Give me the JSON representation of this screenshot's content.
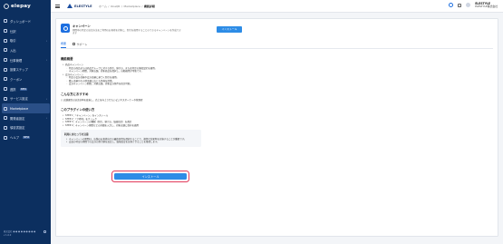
{
  "sidebar": {
    "brand": "elepay",
    "items": [
      {
        "label": "ダッシュボード",
        "icon": "dashboard-icon",
        "caret": false,
        "badge": ""
      },
      {
        "label": "仕訳",
        "icon": "journal-icon",
        "caret": false,
        "badge": ""
      },
      {
        "label": "取引",
        "icon": "transaction-icon",
        "caret": true,
        "badge": ""
      },
      {
        "label": "入出",
        "icon": "wallet-icon",
        "caret": false,
        "badge": ""
      },
      {
        "label": "仕事管理",
        "icon": "briefcase-icon",
        "caret": true,
        "badge": ""
      },
      {
        "label": "設置ステップ",
        "icon": "steps-icon",
        "caret": false,
        "badge": ""
      },
      {
        "label": "クーポン",
        "icon": "coupon-icon",
        "caret": false,
        "badge": ""
      },
      {
        "label": "連携",
        "icon": "link-icon",
        "caret": false,
        "badge": "NEW"
      },
      {
        "label": "サービス設定",
        "icon": "settings-icon",
        "caret": true,
        "badge": ""
      },
      {
        "label": "Marketplace",
        "icon": "marketplace-icon",
        "caret": false,
        "badge": "",
        "active": true
      },
      {
        "label": "開発者設定",
        "icon": "developer-icon",
        "caret": true,
        "badge": ""
      },
      {
        "label": "領収書設定",
        "icon": "receipt-icon",
        "caret": false,
        "badge": ""
      },
      {
        "label": "ヘルプ",
        "icon": "help-icon",
        "caret": false,
        "badge": "NEW"
      }
    ],
    "footer_lines": [
      "株式会社 ● ● ● ● ● ● ● ● ●",
      "v 1.0.0"
    ]
  },
  "header": {
    "logo_text": "ELESTYLE",
    "breadcrumb": [
      "ホーム",
      "/",
      "OneQR",
      "/",
      "Marketplace",
      "/",
      "機能詳細"
    ],
    "user_name": "ELESTYLE",
    "user_sub": "ELESTYLE株式会社"
  },
  "plugin": {
    "name": "キャンペーン",
    "description": "期間中の特定の決済方法をご利用のお客様を対象に、割引を適用することのできるキャンペーンを作成できます",
    "install_top_label": "インストール"
  },
  "tabs": [
    {
      "label": "概要",
      "active": true
    },
    {
      "label": "サポート",
      "active": false
    }
  ],
  "content": {
    "overview_title": "機能概要",
    "overview_items": [
      {
        "text": "商品キャンペーン",
        "level": 1
      },
      {
        "text": "特定の商品または商品グループに対する割引、値引き、または特定の値段設定を適用。",
        "level": 2
      },
      {
        "text": "キャンペーン期間、対象店舗、対象商品を選択し、自動適用が可能です。",
        "level": 2
      },
      {
        "text": "会計キャンペーン",
        "level": 1
      },
      {
        "text": "特定の会計金額や会計金額に基づく割引を適用。",
        "level": 2
      },
      {
        "text": "購入金額やその他金額に応じた特典を提供。",
        "level": 2
      },
      {
        "text": "会計キャンペーン期間、対象店舗、対象会計条件を指定可能。",
        "level": 2
      }
    ],
    "recommend_title": "こんな方におすすめ",
    "recommend_text": "○ 店舗運営の決済効率を改善し、売上を向上させたいビジネスオーナーや管理者",
    "howto_title": "このプラグインの使い方",
    "howto_items": [
      "STEP 1：「キャンペーン」をインストール",
      "STEP 2：「フ素地」をクリック",
      "STEP 3：キャンペーンの種類（割引、値引き、価格指定）を選定",
      "STEP 4：キャンペーン期間などの詳細を入力し、対象店舗に保存を適用"
    ],
    "note_title": "利用にあたっての注意",
    "note_items": [
      "キャンペーンの期間は、店舗のお客様向けの最終日程を選択することで、適切な効果率を実施することが重要です。",
      "会員の特定の期間での会計の割引値を設定し、価格改定を反映させることを推奨します。"
    ],
    "install_main_label": "インストール"
  }
}
